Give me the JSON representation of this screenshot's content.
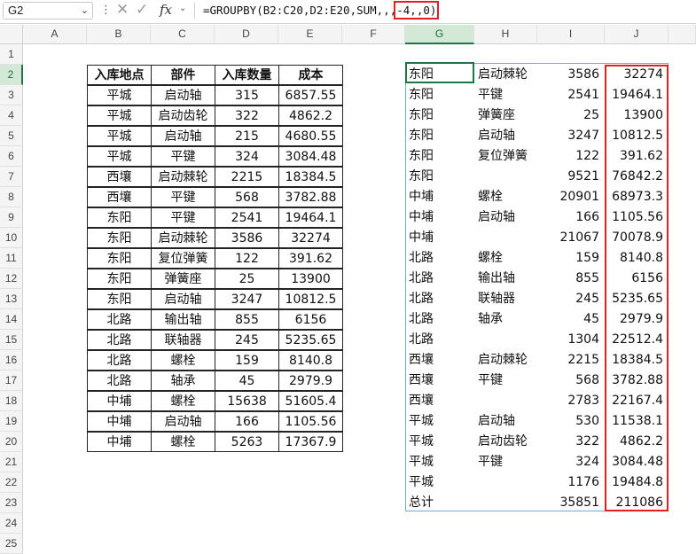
{
  "formula_bar": {
    "name_box": "G2",
    "fx_label": "fx",
    "formula_prefix": "=GROUPBY(B2:C20,D2:E20,SUM,,,",
    "formula_highlight": "-4,,0)"
  },
  "columns": [
    "A",
    "B",
    "C",
    "D",
    "E",
    "F",
    "G",
    "H",
    "I",
    "J"
  ],
  "rows": [
    "1",
    "2",
    "3",
    "4",
    "5",
    "6",
    "7",
    "8",
    "9",
    "10",
    "11",
    "12",
    "13",
    "14",
    "15",
    "16",
    "17",
    "18",
    "19",
    "20",
    "21",
    "22",
    "23",
    "24",
    "25"
  ],
  "source_table": {
    "headers": [
      "入库地点",
      "部件",
      "入库数量",
      "成本"
    ],
    "rows": [
      [
        "平城",
        "启动轴",
        "315",
        "6857.55"
      ],
      [
        "平城",
        "启动齿轮",
        "322",
        "4862.2"
      ],
      [
        "平城",
        "启动轴",
        "215",
        "4680.55"
      ],
      [
        "平城",
        "平键",
        "324",
        "3084.48"
      ],
      [
        "西壤",
        "启动棘轮",
        "2215",
        "18384.5"
      ],
      [
        "西壤",
        "平键",
        "568",
        "3782.88"
      ],
      [
        "东阳",
        "平键",
        "2541",
        "19464.1"
      ],
      [
        "东阳",
        "启动棘轮",
        "3586",
        "32274"
      ],
      [
        "东阳",
        "复位弹簧",
        "122",
        "391.62"
      ],
      [
        "东阳",
        "弹簧座",
        "25",
        "13900"
      ],
      [
        "东阳",
        "启动轴",
        "3247",
        "10812.5"
      ],
      [
        "北路",
        "输出轴",
        "855",
        "6156"
      ],
      [
        "北路",
        "联轴器",
        "245",
        "5235.65"
      ],
      [
        "北路",
        "螺栓",
        "159",
        "8140.8"
      ],
      [
        "北路",
        "轴承",
        "45",
        "2979.9"
      ],
      [
        "中埔",
        "螺栓",
        "15638",
        "51605.4"
      ],
      [
        "中埔",
        "启动轴",
        "166",
        "1105.56"
      ],
      [
        "中埔",
        "螺栓",
        "5263",
        "17367.9"
      ]
    ]
  },
  "result_table": {
    "rows": [
      [
        "东阳",
        "启动棘轮",
        "3586",
        "32274"
      ],
      [
        "东阳",
        "平键",
        "2541",
        "19464.1"
      ],
      [
        "东阳",
        "弹簧座",
        "25",
        "13900"
      ],
      [
        "东阳",
        "启动轴",
        "3247",
        "10812.5"
      ],
      [
        "东阳",
        "复位弹簧",
        "122",
        "391.62"
      ],
      [
        "东阳",
        "",
        "9521",
        "76842.2"
      ],
      [
        "中埔",
        "螺栓",
        "20901",
        "68973.3"
      ],
      [
        "中埔",
        "启动轴",
        "166",
        "1105.56"
      ],
      [
        "中埔",
        "",
        "21067",
        "70078.9"
      ],
      [
        "北路",
        "螺栓",
        "159",
        "8140.8"
      ],
      [
        "北路",
        "输出轴",
        "855",
        "6156"
      ],
      [
        "北路",
        "联轴器",
        "245",
        "5235.65"
      ],
      [
        "北路",
        "轴承",
        "45",
        "2979.9"
      ],
      [
        "北路",
        "",
        "1304",
        "22512.4"
      ],
      [
        "西壤",
        "启动棘轮",
        "2215",
        "18384.5"
      ],
      [
        "西壤",
        "平键",
        "568",
        "3782.88"
      ],
      [
        "西壤",
        "",
        "2783",
        "22167.4"
      ],
      [
        "平城",
        "启动轴",
        "530",
        "11538.1"
      ],
      [
        "平城",
        "启动齿轮",
        "322",
        "4862.2"
      ],
      [
        "平城",
        "平键",
        "324",
        "3084.48"
      ],
      [
        "平城",
        "",
        "1176",
        "19484.8"
      ],
      [
        "总计",
        "",
        "35851",
        "211086"
      ]
    ]
  }
}
